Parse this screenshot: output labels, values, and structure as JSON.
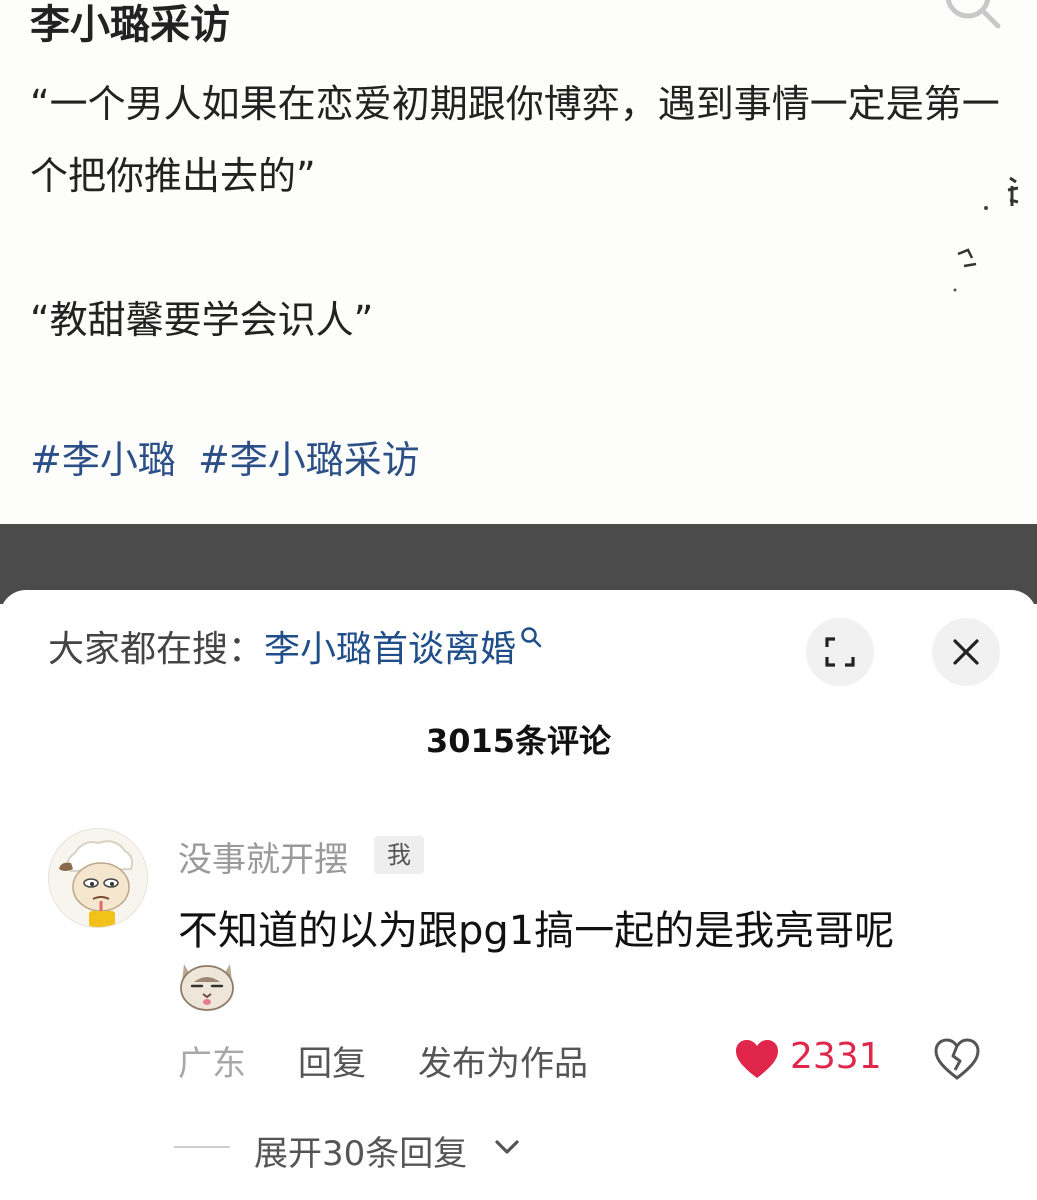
{
  "post": {
    "title": "李小璐采访",
    "paragraph1": "“一个男人如果在恋爱初期跟你博弈，遇到事情一定是第一个把你推出去的”",
    "paragraph2": "“教甜馨要学会识人”",
    "tags": [
      "#李小璐",
      "#李小璐采访"
    ]
  },
  "comments_panel": {
    "hot_search_prefix": "大家都在搜：",
    "hot_search_link": "李小璐首谈离婚",
    "count_label": "3015条评论",
    "expand_icon": "expand-icon",
    "close_icon": "close-icon"
  },
  "comment": {
    "username": "没事就开摆",
    "badge": "我",
    "text": "不知道的以为跟pg1搞一起的是我亮哥呢",
    "emoji": "cat-emoji",
    "location": "广东",
    "reply_label": "回复",
    "publish_label": "发布为作品",
    "like_count": "2331",
    "expand_replies": "展开30条回复"
  },
  "colors": {
    "tag_blue": "#2b4f86",
    "link_blue": "#1f4e8a",
    "like_red": "#e0264b",
    "dim_band": "#4a4b4a"
  }
}
